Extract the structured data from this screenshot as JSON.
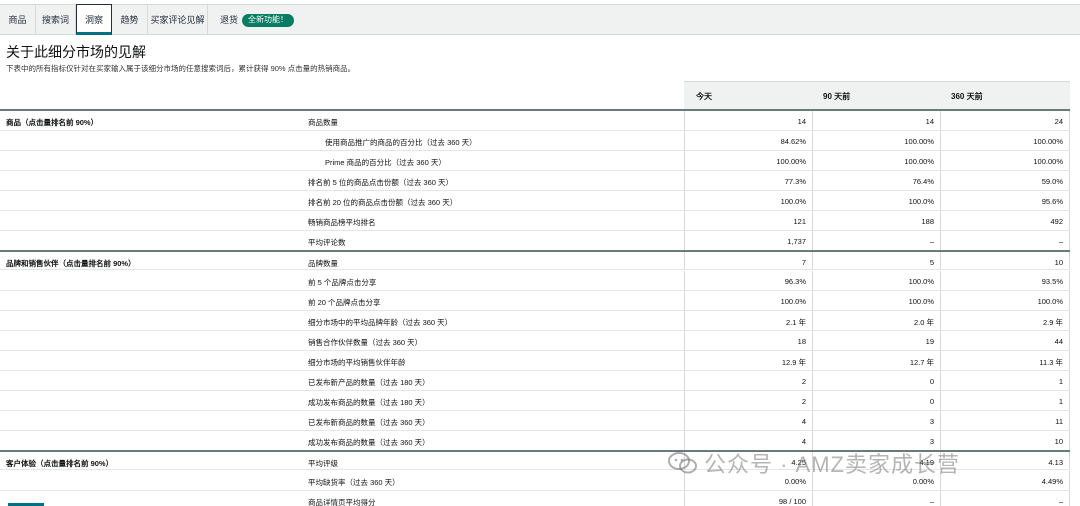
{
  "tabs": [
    {
      "label": "商品",
      "name": "tab-products",
      "active": false
    },
    {
      "label": "搜索词",
      "name": "tab-search-terms",
      "active": false
    },
    {
      "label": "洞察",
      "name": "tab-insights",
      "active": true
    },
    {
      "label": "趋势",
      "name": "tab-trends",
      "active": false
    },
    {
      "label": "买家评论见解",
      "name": "tab-review-insights",
      "active": false
    },
    {
      "label": "退货",
      "name": "tab-returns",
      "active": false
    }
  ],
  "new_badge": "全新功能！",
  "page_title": "关于此细分市场的见解",
  "description": "下表中的所有指标仅针对在买家输入属于该细分市场的任意搜索词后，累计获得 90% 点击量的热销商品。",
  "columns": [
    "今天",
    "90 天前",
    "360 天前"
  ],
  "rows": [
    {
      "category": "商品（点击量排名前 90%）",
      "metric": "商品数量",
      "indent": false,
      "values": [
        "14",
        "14",
        "24"
      ]
    },
    {
      "category": "",
      "metric": "使用商品推广的商品的百分比（过去 360 天）",
      "indent": true,
      "values": [
        "84.62%",
        "100.00%",
        "100.00%"
      ]
    },
    {
      "category": "",
      "metric": "Prime 商品的百分比（过去 360 天）",
      "indent": true,
      "values": [
        "100.00%",
        "100.00%",
        "100.00%"
      ]
    },
    {
      "category": "",
      "metric": "排名前 5 位的商品点击份额（过去 360 天）",
      "indent": false,
      "values": [
        "77.3%",
        "76.4%",
        "59.0%"
      ]
    },
    {
      "category": "",
      "metric": "排名前 20 位的商品点击份额（过去 360 天）",
      "indent": false,
      "values": [
        "100.0%",
        "100.0%",
        "95.6%"
      ]
    },
    {
      "category": "",
      "metric": "畅销商品榜平均排名",
      "indent": false,
      "values": [
        "121",
        "188",
        "492"
      ]
    },
    {
      "category": "",
      "metric": "平均评论数",
      "indent": false,
      "values": [
        "1,737",
        "–",
        "–"
      ]
    },
    {
      "category": "品牌和销售伙伴（点击量排名前 90%）",
      "metric": "品牌数量",
      "indent": false,
      "values": [
        "7",
        "5",
        "10"
      ]
    },
    {
      "category": "",
      "metric": "前 5 个品牌点击分享",
      "indent": false,
      "values": [
        "96.3%",
        "100.0%",
        "93.5%"
      ]
    },
    {
      "category": "",
      "metric": "前 20 个品牌点击分享",
      "indent": false,
      "values": [
        "100.0%",
        "100.0%",
        "100.0%"
      ]
    },
    {
      "category": "",
      "metric": "细分市场中的平均品牌年龄（过去 360 天）",
      "indent": false,
      "values": [
        "2.1 年",
        "2.0 年",
        "2.9 年"
      ]
    },
    {
      "category": "",
      "metric": "销售合作伙伴数量（过去 360 天）",
      "indent": false,
      "values": [
        "18",
        "19",
        "44"
      ]
    },
    {
      "category": "",
      "metric": "细分市场的平均销售伙伴年龄",
      "indent": false,
      "values": [
        "12.9 年",
        "12.7 年",
        "11.3 年"
      ]
    },
    {
      "category": "",
      "metric": "已发布新产品的数量（过去 180 天）",
      "indent": false,
      "values": [
        "2",
        "0",
        "1"
      ]
    },
    {
      "category": "",
      "metric": "成功发布商品的数量（过去 180 天）",
      "indent": false,
      "values": [
        "2",
        "0",
        "1"
      ]
    },
    {
      "category": "",
      "metric": "已发布新商品的数量（过去 360 天）",
      "indent": false,
      "values": [
        "4",
        "3",
        "11"
      ]
    },
    {
      "category": "",
      "metric": "成功发布商品的数量（过去 360 天）",
      "indent": false,
      "values": [
        "4",
        "3",
        "10"
      ]
    },
    {
      "category": "客户体验（点击量排名前 90%）",
      "metric": "平均评级",
      "indent": false,
      "values": [
        "4.25",
        "4.19",
        "4.13"
      ]
    },
    {
      "category": "",
      "metric": "平均缺货率（过去 360 天）",
      "indent": false,
      "values": [
        "0.00%",
        "0.00%",
        "4.49%"
      ]
    },
    {
      "category": "",
      "metric": "商品详情页平均得分",
      "indent": false,
      "values": [
        "98 / 100",
        "–",
        "–"
      ]
    }
  ],
  "watermark": "公众号 · AMZ卖家成长营",
  "colors": {
    "accent": "#007185",
    "badge": "#067d62",
    "header_bg": "#f0f2f2"
  }
}
